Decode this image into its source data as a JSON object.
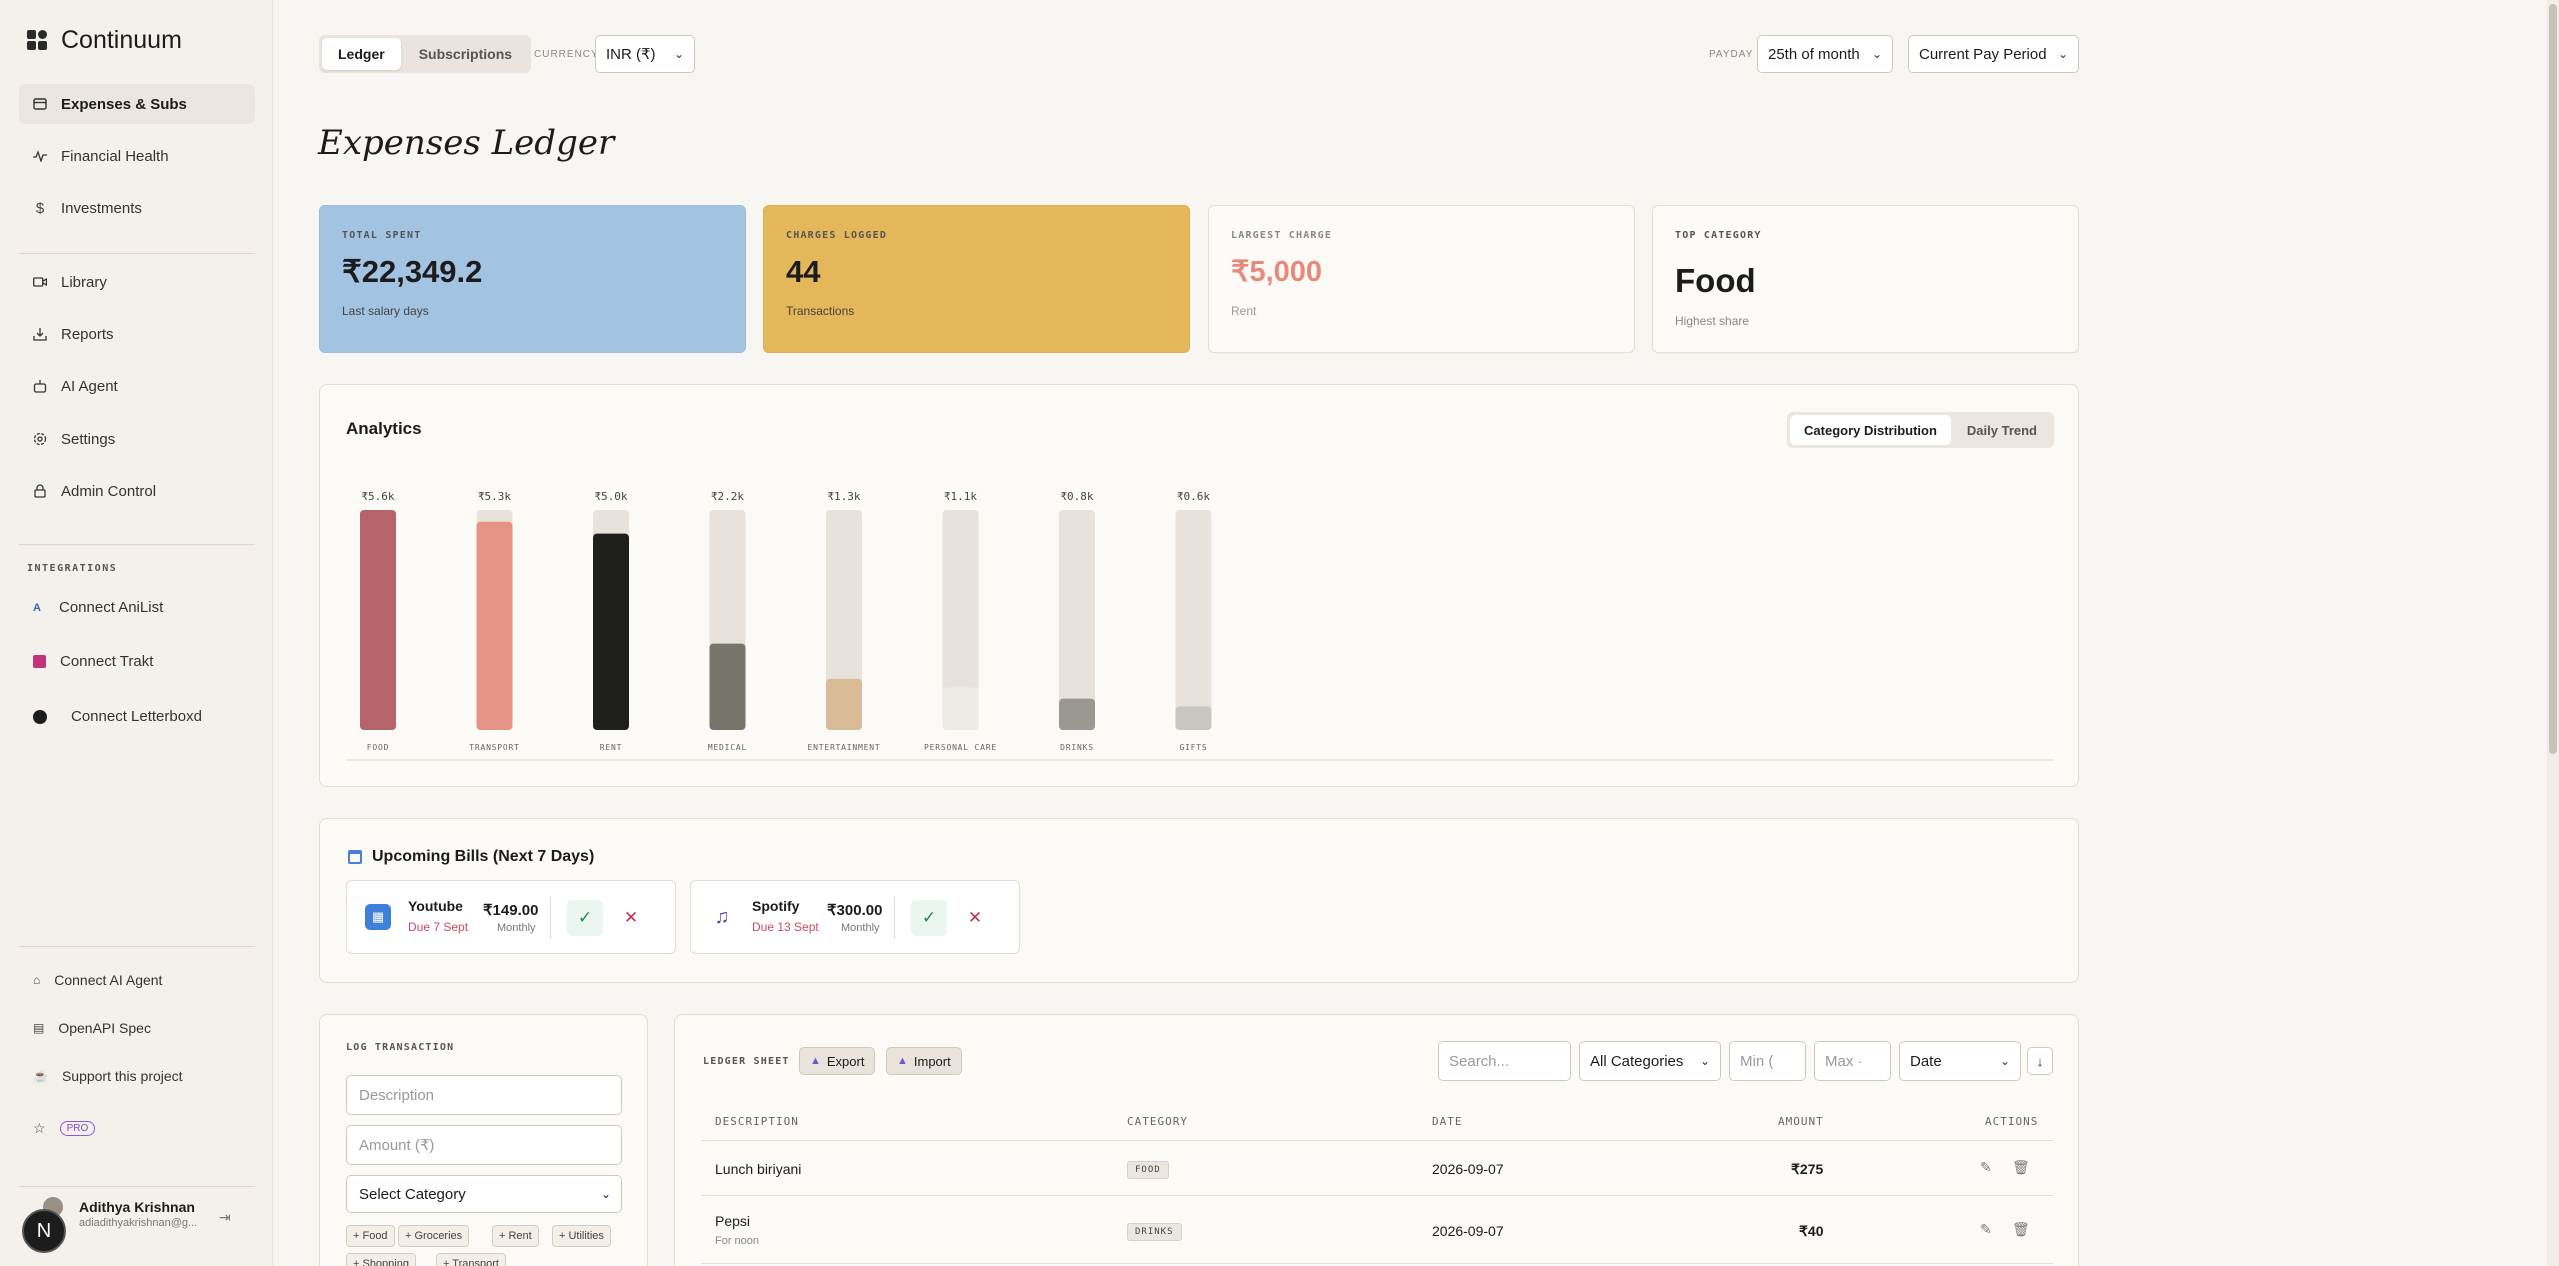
{
  "app": {
    "name": "Continuum"
  },
  "sidebar": {
    "items": [
      {
        "label": "Expenses & Subs",
        "icon": "card-icon"
      },
      {
        "label": "Financial Health",
        "icon": "pulse-icon"
      },
      {
        "label": "Investments",
        "icon": "dollar-icon"
      },
      {
        "label": "Library",
        "icon": "video-icon"
      },
      {
        "label": "Reports",
        "icon": "download-icon"
      },
      {
        "label": "AI Agent",
        "icon": "bot-icon"
      },
      {
        "label": "Settings",
        "icon": "gear-icon"
      },
      {
        "label": "Admin Control",
        "icon": "lock-icon"
      }
    ],
    "integrations_label": "INTEGRATIONS",
    "integrations": [
      {
        "label": "Connect AniList",
        "icon": "anilist-icon"
      },
      {
        "label": "Connect Trakt",
        "icon": "trakt-icon"
      },
      {
        "label": "Connect Letterboxd",
        "icon": "letterboxd-icon"
      }
    ],
    "footer": [
      {
        "label": "Connect AI Agent",
        "icon": "bot-icon"
      },
      {
        "label": "OpenAPI Spec",
        "icon": "book-icon"
      },
      {
        "label": "Support this project",
        "icon": "coffee-icon"
      }
    ],
    "pro_label": "PRO",
    "user": {
      "name": "Adithya Krishnan",
      "email": "adiadithyakrishnan@g...",
      "avatar_letter": "N"
    }
  },
  "topbar": {
    "tabs": [
      {
        "label": "Ledger",
        "active": true
      },
      {
        "label": "Subscriptions",
        "active": false
      }
    ],
    "currency_label": "CURRENCY",
    "currency_value": "INR (₹)",
    "payday_label": "PAYDAY",
    "payday_value": "25th of month",
    "period_value": "Current Pay Period"
  },
  "page_title": "Expenses Ledger",
  "kpis": [
    {
      "label": "TOTAL SPENT",
      "value": "₹22,349.2",
      "sub": "Last salary days",
      "bg": "#a3c3e3"
    },
    {
      "label": "CHARGES LOGGED",
      "value": "44",
      "sub": "Transactions",
      "bg": "#e3b75a"
    },
    {
      "label": "LARGEST CHARGE",
      "value": "₹5,000",
      "sub": "Rent",
      "bg": "#fbfaf7",
      "value_color": "#e78a7c"
    },
    {
      "label": "TOP CATEGORY",
      "value": "Food",
      "sub": "Highest share",
      "bg": "#fbfaf7"
    }
  ],
  "analytics": {
    "title": "Analytics",
    "tabs": [
      {
        "label": "Category Distribution",
        "active": true
      },
      {
        "label": "Daily Trend",
        "active": false
      }
    ]
  },
  "chart_data": {
    "type": "bar",
    "categories": [
      "FOOD",
      "TRANSPORT",
      "RENT",
      "MEDICAL",
      "ENTERTAINMENT",
      "PERSONAL CARE",
      "DRINKS",
      "GIFTS"
    ],
    "values": [
      5.6,
      5.3,
      5.0,
      2.2,
      1.3,
      1.1,
      0.8,
      0.6
    ],
    "value_labels": [
      "₹5.6k",
      "₹5.3k",
      "₹5.0k",
      "₹2.2k",
      "₹1.3k",
      "₹1.1k",
      "₹0.8k",
      "₹0.6k"
    ],
    "colors": [
      "#b5646b",
      "#e49384",
      "#1e1e1c",
      "#76756b",
      "#d9bb95",
      "#eceae4",
      "#9a9890",
      "#c8c6c0"
    ],
    "track_color": "#e7e3dc",
    "max": 5.6
  },
  "bills": {
    "title": "Upcoming Bills (Next 7 Days)",
    "items": [
      {
        "name": "Youtube",
        "due": "Due 7 Sept",
        "amount": "₹149.00",
        "period": "Monthly",
        "icon": "app-icon"
      },
      {
        "name": "Spotify",
        "due": "Due 13 Sept",
        "amount": "₹300.00",
        "period": "Monthly",
        "icon": "music-icon"
      }
    ],
    "ok_glyph": "✓",
    "x_glyph": "✕"
  },
  "log": {
    "title": "LOG TRANSACTION",
    "description_placeholder": "Description",
    "amount_placeholder": "Amount (₹)",
    "category_value": "Select Category",
    "chips": [
      "+ Food",
      "+ Groceries",
      "+ Rent",
      "+ Utilities",
      "+ Shopping",
      "+ Transport"
    ]
  },
  "ledger": {
    "title": "LEDGER SHEET",
    "export_label": "Export",
    "import_label": "Import",
    "search_placeholder": "Search...",
    "category_filter": "All Categories",
    "min_placeholder": "Min (",
    "max_placeholder": "Max ·",
    "sort_value": "Date",
    "sort_dir": "↓",
    "columns": [
      "DESCRIPTION",
      "CATEGORY",
      "DATE",
      "AMOUNT",
      "ACTIONS"
    ],
    "rows": [
      {
        "description": "Lunch biriyani",
        "note": "",
        "category": "FOOD",
        "date": "2026-09-07",
        "amount": "₹275"
      },
      {
        "description": "Pepsi",
        "note": "For noon",
        "category": "DRINKS",
        "date": "2026-09-07",
        "amount": "₹40"
      }
    ]
  }
}
